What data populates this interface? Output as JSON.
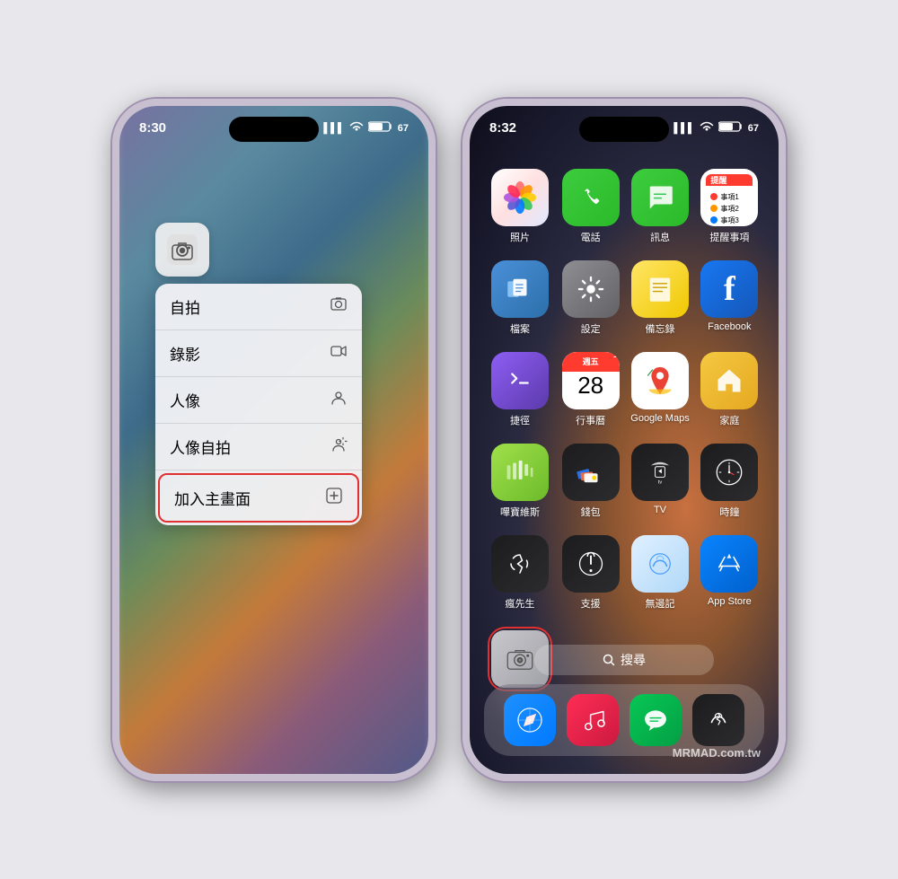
{
  "phone1": {
    "time": "8:30",
    "signal": "●●●",
    "wifi": "wifi",
    "battery": "67",
    "menu": {
      "camera_icon": "camera",
      "items": [
        {
          "label": "自拍",
          "icon": "portrait"
        },
        {
          "label": "錄影",
          "icon": "video"
        },
        {
          "label": "人像",
          "icon": "person"
        },
        {
          "label": "人像自拍",
          "icon": "person-front"
        },
        {
          "label": "加入主畫面",
          "icon": "plus-square",
          "highlighted": true
        }
      ]
    }
  },
  "phone2": {
    "time": "8:32",
    "signal": "●●●",
    "wifi": "wifi",
    "battery": "67",
    "apps": [
      {
        "label": "照片",
        "icon": "photos"
      },
      {
        "label": "電話",
        "icon": "phone"
      },
      {
        "label": "訊息",
        "icon": "messages"
      },
      {
        "label": "提醒事項",
        "icon": "reminders"
      },
      {
        "label": "檔案",
        "icon": "files"
      },
      {
        "label": "設定",
        "icon": "settings"
      },
      {
        "label": "備忘錄",
        "icon": "notes"
      },
      {
        "label": "Facebook",
        "icon": "facebook"
      },
      {
        "label": "捷徑",
        "icon": "shortcuts"
      },
      {
        "label": "行事曆",
        "icon": "calendar",
        "badge": "1",
        "weekday": "週五",
        "day": "28"
      },
      {
        "label": "Google Maps",
        "icon": "googlemaps"
      },
      {
        "label": "家庭",
        "icon": "home"
      },
      {
        "label": "嗶寶維斯",
        "icon": "deezer"
      },
      {
        "label": "錢包",
        "icon": "wallet"
      },
      {
        "label": "TV",
        "icon": "appletv"
      },
      {
        "label": "時鐘",
        "icon": "clock"
      },
      {
        "label": "瘋先生",
        "icon": "madsense"
      },
      {
        "label": "支援",
        "icon": "support"
      },
      {
        "label": "無邊記",
        "icon": "notchless"
      },
      {
        "label": "App Store",
        "icon": "appstore"
      },
      {
        "label": "相機",
        "icon": "camera-home",
        "highlighted": true
      }
    ],
    "search": "搜尋",
    "dock": [
      {
        "label": "Safari",
        "icon": "safari"
      },
      {
        "label": "音樂",
        "icon": "music"
      },
      {
        "label": "LINE",
        "icon": "line"
      },
      {
        "label": "瘋先生",
        "icon": "madsense-dock"
      }
    ]
  },
  "watermark": "MRMAD.com.tw"
}
